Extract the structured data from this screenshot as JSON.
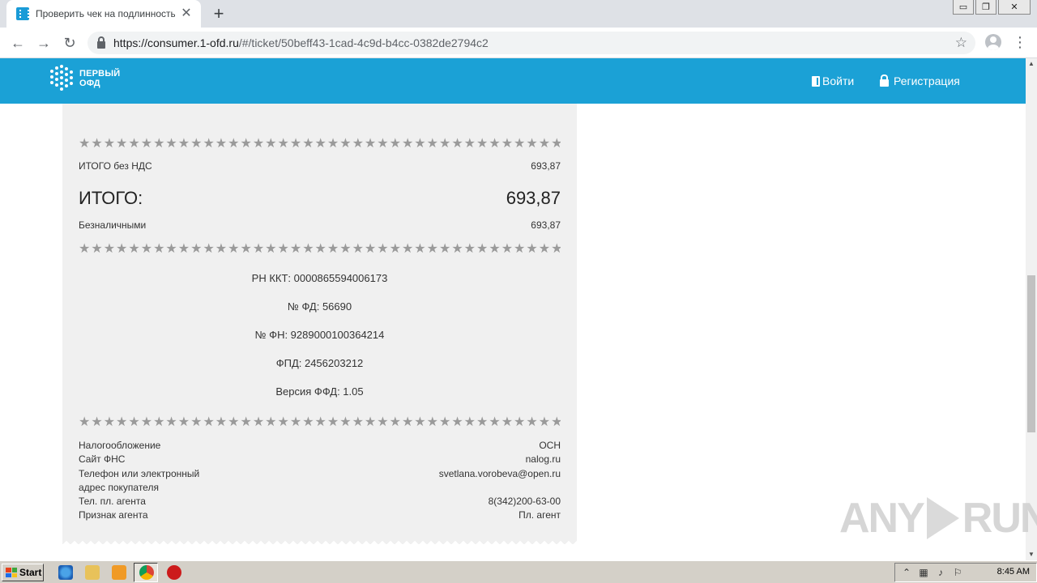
{
  "browser": {
    "tab_title": "Проверить чек на подлинность он",
    "tab_close": "✕",
    "new_tab": "+",
    "url_host": "https://consumer.1-ofd.ru",
    "url_path": "/#/ticket/50beff43-1cad-4c9d-b4cc-0382de2794c2",
    "window_controls": [
      "▭",
      "❐",
      "✕"
    ]
  },
  "site": {
    "logo_line1": "ПЕРВЫЙ",
    "logo_line2": "ОФД",
    "login_label": "Войти",
    "register_label": "Регистрация",
    "header_color": "#1ba1d6"
  },
  "receipt": {
    "stars": "★★★★★★★★★★★★★★★★★★★★★★★★★★★★★★★★★★★★★★★★",
    "total_wo_vat_label": "ИТОГО без НДС",
    "total_wo_vat_value": "693,87",
    "total_label": "ИТОГО:",
    "total_value": "693,87",
    "cashless_label": "Безналичными",
    "cashless_value": "693,87",
    "rn_kkt": "РН ККТ: 0000865594006173",
    "fd_number": "№ ФД: 56690",
    "fn_number": "№ ФН: 9289000100364214",
    "fpd": "ФПД: 2456203212",
    "ffd_version": "Версия ФФД: 1.05",
    "details": [
      {
        "label": "Налогообложение",
        "value": "ОСН"
      },
      {
        "label": "Сайт ФНС",
        "value": "nalog.ru"
      },
      {
        "label": "Телефон или электронный адрес покупателя",
        "value": "svetlana.vorobeva@open.ru"
      },
      {
        "label": "Тел. пл. агента",
        "value": "8(342)200-63-00"
      },
      {
        "label": "Признак агента",
        "value": "Пл. агент"
      }
    ]
  },
  "watermark": {
    "left": "ANY",
    "right": "RUN"
  },
  "taskbar": {
    "start_label": "Start",
    "clock": "8:45 AM"
  }
}
